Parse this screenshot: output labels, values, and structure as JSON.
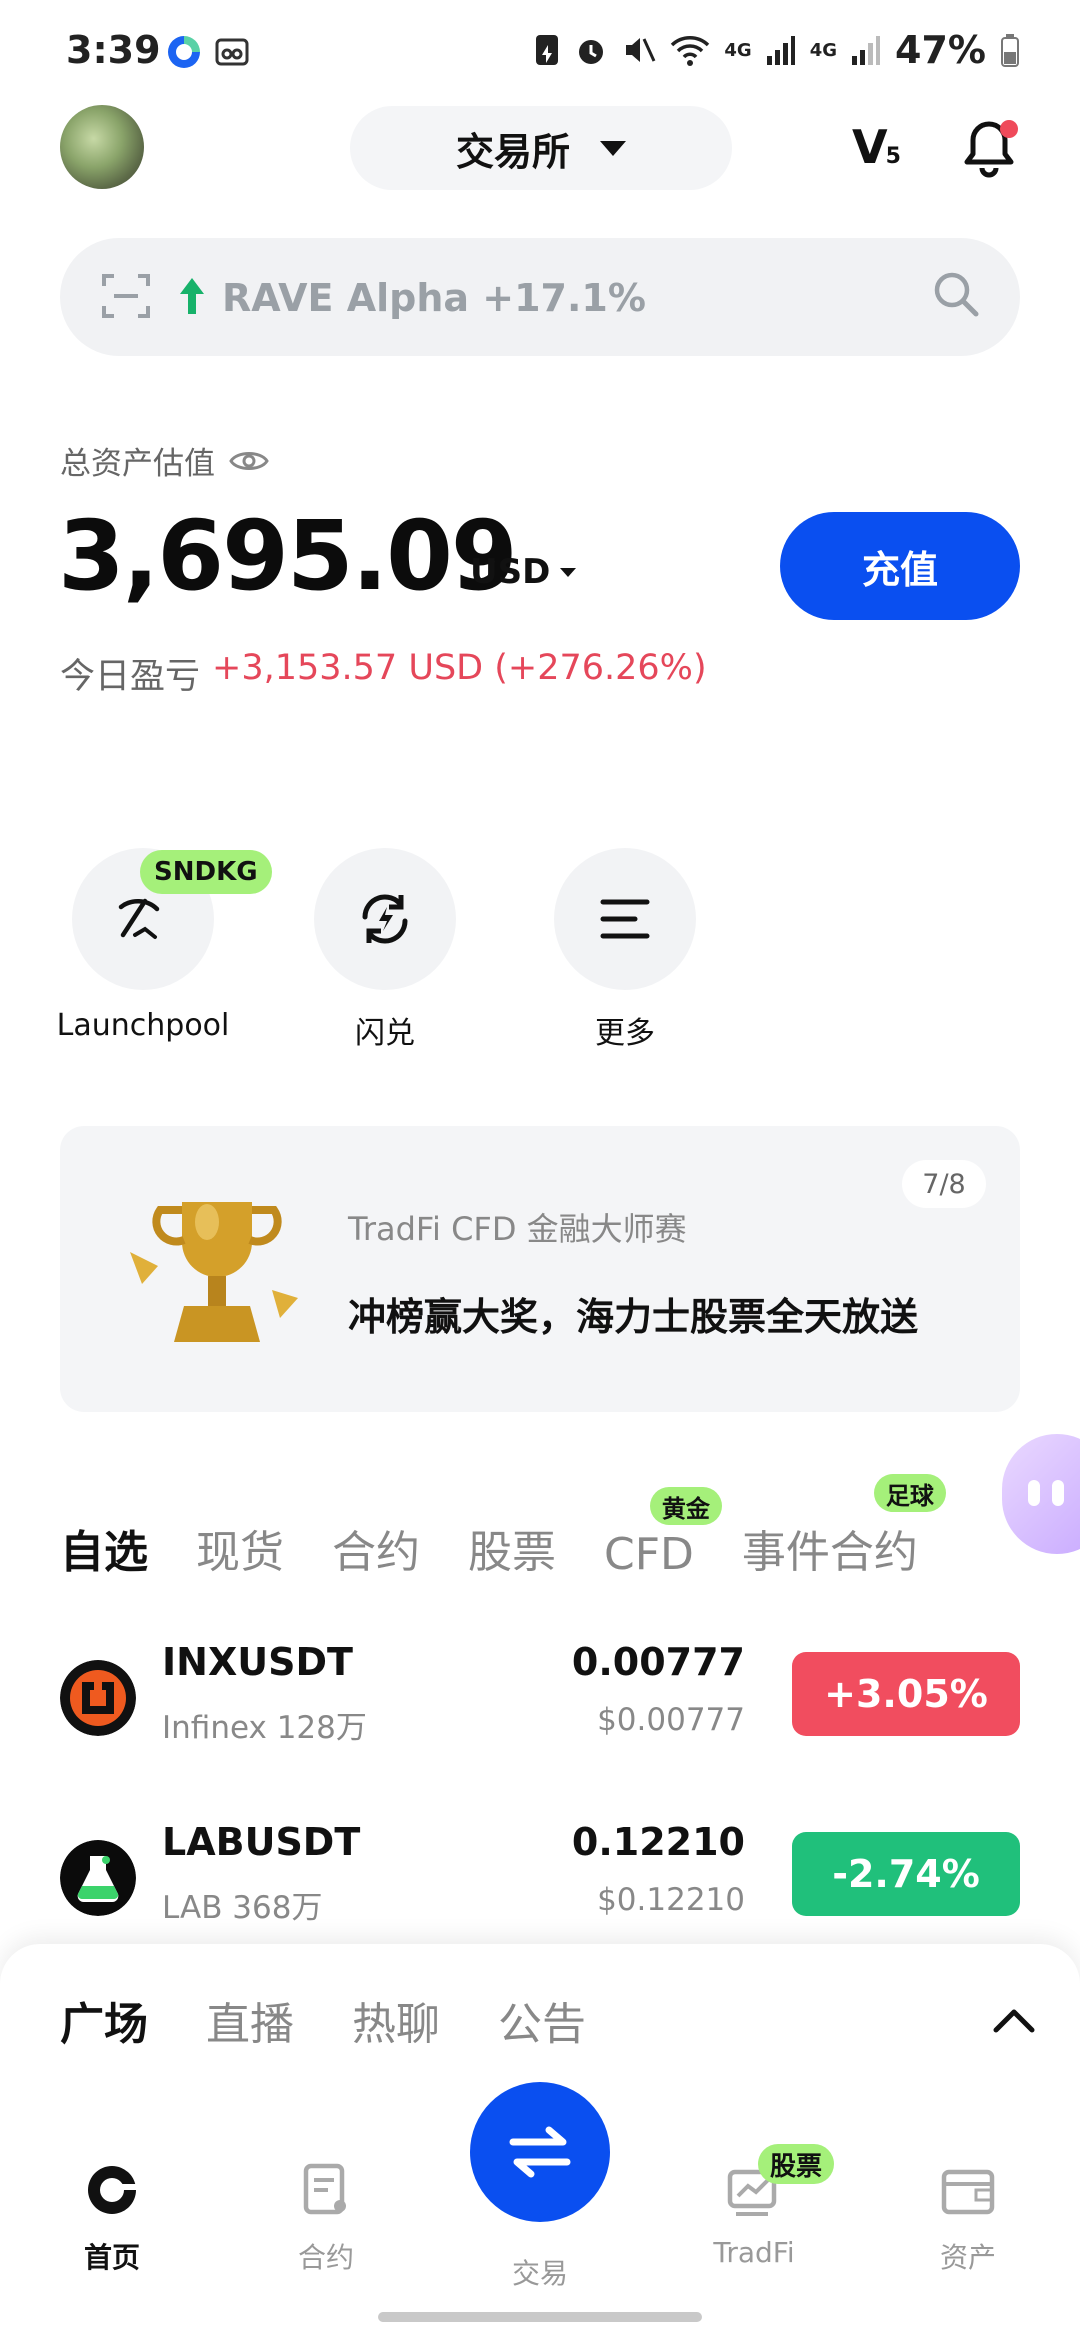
{
  "status_bar": {
    "time": "3:39",
    "battery": "47%",
    "net1": "4G",
    "net2": "4G"
  },
  "header": {
    "exchange_label": "交易所",
    "vip_letter": "V",
    "vip_level": "5"
  },
  "search": {
    "hot_text": "RAVE Alpha +17.1%"
  },
  "assets": {
    "label": "总资产估值",
    "value": "3,695.09",
    "unit": "USD",
    "deposit_label": "充值",
    "pnl_label": "今日盈亏",
    "pnl_value": "+3,153.57 USD (+276.26%)"
  },
  "quick_actions": [
    {
      "label": "Launchpool",
      "badge": "SNDKG"
    },
    {
      "label": "闪兑"
    },
    {
      "label": "更多"
    }
  ],
  "banner": {
    "subtitle": "TradFi CFD 金融大师赛",
    "title": "冲榜赢大奖，海力士股票全天放送",
    "counter": "7/8"
  },
  "market_tabs": [
    {
      "label": "自选",
      "active": true
    },
    {
      "label": "现货"
    },
    {
      "label": "合约"
    },
    {
      "label": "股票"
    },
    {
      "label": "CFD",
      "badge": "黄金"
    },
    {
      "label": "事件合约",
      "badge": "足球"
    }
  ],
  "rows": [
    {
      "symbol": "INXUSDT",
      "sub": "Infinex 128万",
      "price": "0.00777",
      "usd": "$0.00777",
      "change": "+3.05%",
      "dir": "up"
    },
    {
      "symbol": "LABUSDT",
      "sub": "LAB 368万",
      "price": "0.12210",
      "usd": "$0.12210",
      "change": "-2.74%",
      "dir": "down"
    }
  ],
  "sheet_tabs": [
    {
      "label": "广场",
      "active": true
    },
    {
      "label": "直播"
    },
    {
      "label": "热聊"
    },
    {
      "label": "公告"
    }
  ],
  "bottom_nav": [
    {
      "label": "首页",
      "active": true
    },
    {
      "label": "合约"
    },
    {
      "label": "交易"
    },
    {
      "label": "TradFi",
      "badge": "股票"
    },
    {
      "label": "资产"
    }
  ],
  "colors": {
    "primary_blue": "#0a4ff0",
    "up_red": "#f14d5f",
    "down_green": "#20c07b",
    "badge_green": "#a5f07a"
  }
}
